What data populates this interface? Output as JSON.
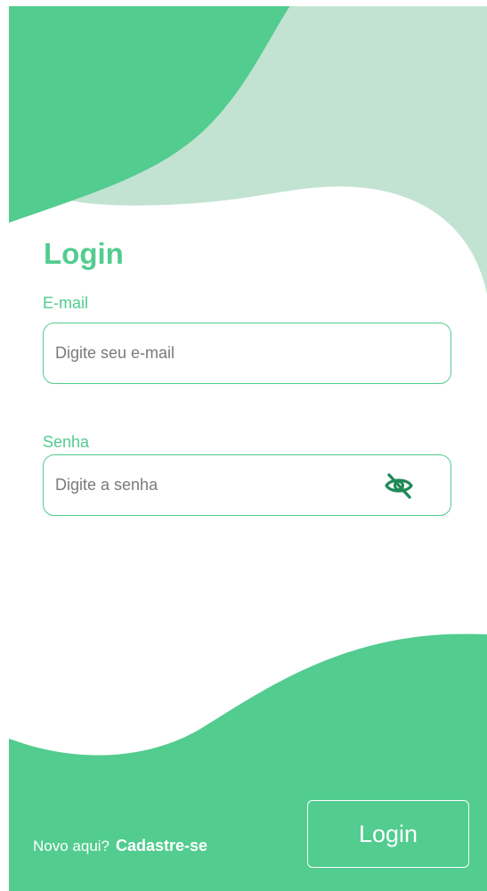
{
  "login_title": "Login",
  "email": {
    "label": "E-mail",
    "placeholder": "Digite seu e-mail",
    "value": ""
  },
  "password": {
    "label": "Senha",
    "placeholder": "Digite a senha",
    "value": "",
    "toggle_icon": "eye-off-icon"
  },
  "footer": {
    "prompt": "Novo aqui?",
    "signup_link": "Cadastre-se"
  },
  "login_button": "Login",
  "colors": {
    "primary": "#52cc8f",
    "light_green": "#c2e3d1",
    "icon_dark_green": "#1e8a57",
    "text_placeholder": "#7a7a7a",
    "background": "#ffffff"
  }
}
